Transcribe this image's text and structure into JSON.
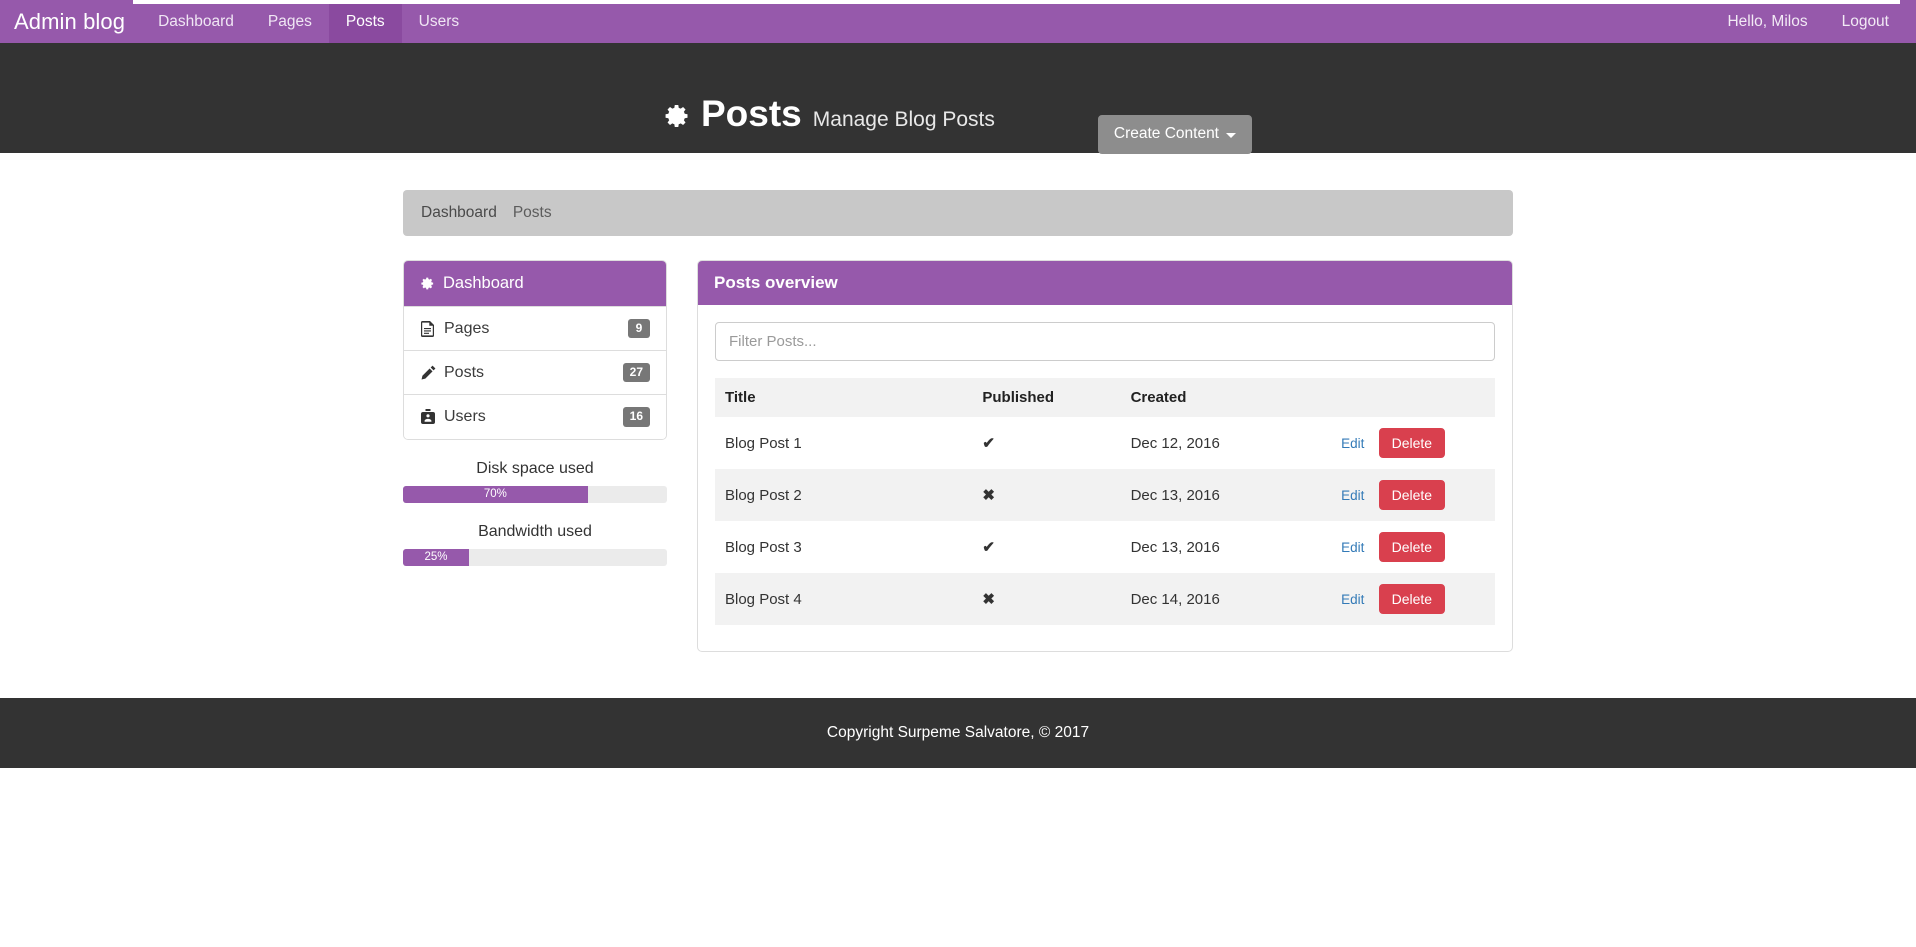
{
  "navbar": {
    "brand": "Admin blog",
    "items": [
      {
        "label": "Dashboard",
        "active": false
      },
      {
        "label": "Pages",
        "active": false
      },
      {
        "label": "Posts",
        "active": true
      },
      {
        "label": "Users",
        "active": false
      }
    ],
    "greeting": "Hello, Milos",
    "logout": "Logout",
    "bg_color": "#9659ab",
    "active_bg_color": "#8a4a9f"
  },
  "header": {
    "icon": "gear-icon",
    "title": "Posts",
    "subtitle": "Manage Blog Posts",
    "create_button": "Create Content",
    "bg_color": "#333333"
  },
  "breadcrumb": {
    "items": [
      {
        "label": "Dashboard",
        "active": false
      },
      {
        "label": "Posts",
        "active": true
      }
    ]
  },
  "sidebar": {
    "header": {
      "icon": "gear-icon",
      "label": "Dashboard"
    },
    "items": [
      {
        "icon": "file-icon",
        "label": "Pages",
        "badge": "9"
      },
      {
        "icon": "pencil-icon",
        "label": "Posts",
        "badge": "27"
      },
      {
        "icon": "users-icon",
        "label": "Users",
        "badge": "16"
      }
    ],
    "meters": [
      {
        "label": "Disk space used",
        "value": 70,
        "text": "70%"
      },
      {
        "label": "Bandwidth used",
        "value": 25,
        "text": "25%"
      }
    ],
    "accent_color": "#9659ab",
    "badge_color": "#777777"
  },
  "panel": {
    "title": "Posts overview",
    "filter_placeholder": "Filter Posts...",
    "filter_value": "",
    "table": {
      "columns": [
        "Title",
        "Published",
        "Created",
        ""
      ],
      "rows": [
        {
          "title": "Blog Post 1",
          "published": "✔",
          "created": "Dec 12, 2016",
          "edit": "Edit",
          "delete": "Delete"
        },
        {
          "title": "Blog Post 2",
          "published": "✖",
          "created": "Dec 13, 2016",
          "edit": "Edit",
          "delete": "Delete"
        },
        {
          "title": "Blog Post 3",
          "published": "✔",
          "created": "Dec 13, 2016",
          "edit": "Edit",
          "delete": "Delete"
        },
        {
          "title": "Blog Post 4",
          "published": "✖",
          "created": "Dec 14, 2016",
          "edit": "Edit",
          "delete": "Delete"
        }
      ]
    },
    "delete_color": "#d9404e",
    "edit_color": "#337ab7"
  },
  "footer": {
    "text": "Copyright Surpeme Salvatore, © 2017"
  }
}
